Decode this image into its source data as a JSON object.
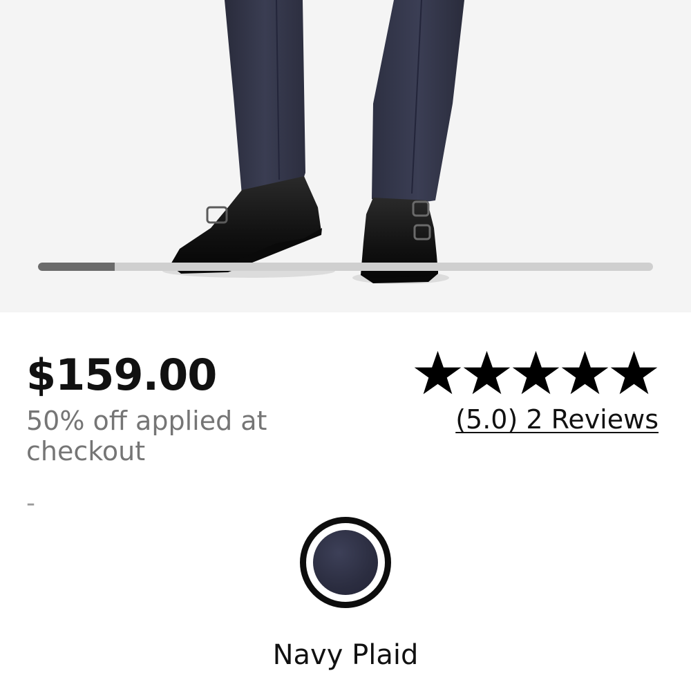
{
  "product": {
    "image_alt": "product-photo-trousers-and-monk-strap-shoes",
    "gallery": {
      "progress_fraction": 0.125
    },
    "price": "$159.00",
    "discount_note": "50% off applied at checkout",
    "price_secondary": "-",
    "rating": {
      "stars": 5,
      "reviews_label": "(5.0) 2 Reviews"
    },
    "color": {
      "selected_name": "Navy Plaid",
      "swatch_color": "#2b2d40"
    }
  },
  "colors": {
    "background": "#ffffff",
    "image_background": "#f4f4f4",
    "text_primary": "#111111",
    "text_secondary": "#757575"
  }
}
